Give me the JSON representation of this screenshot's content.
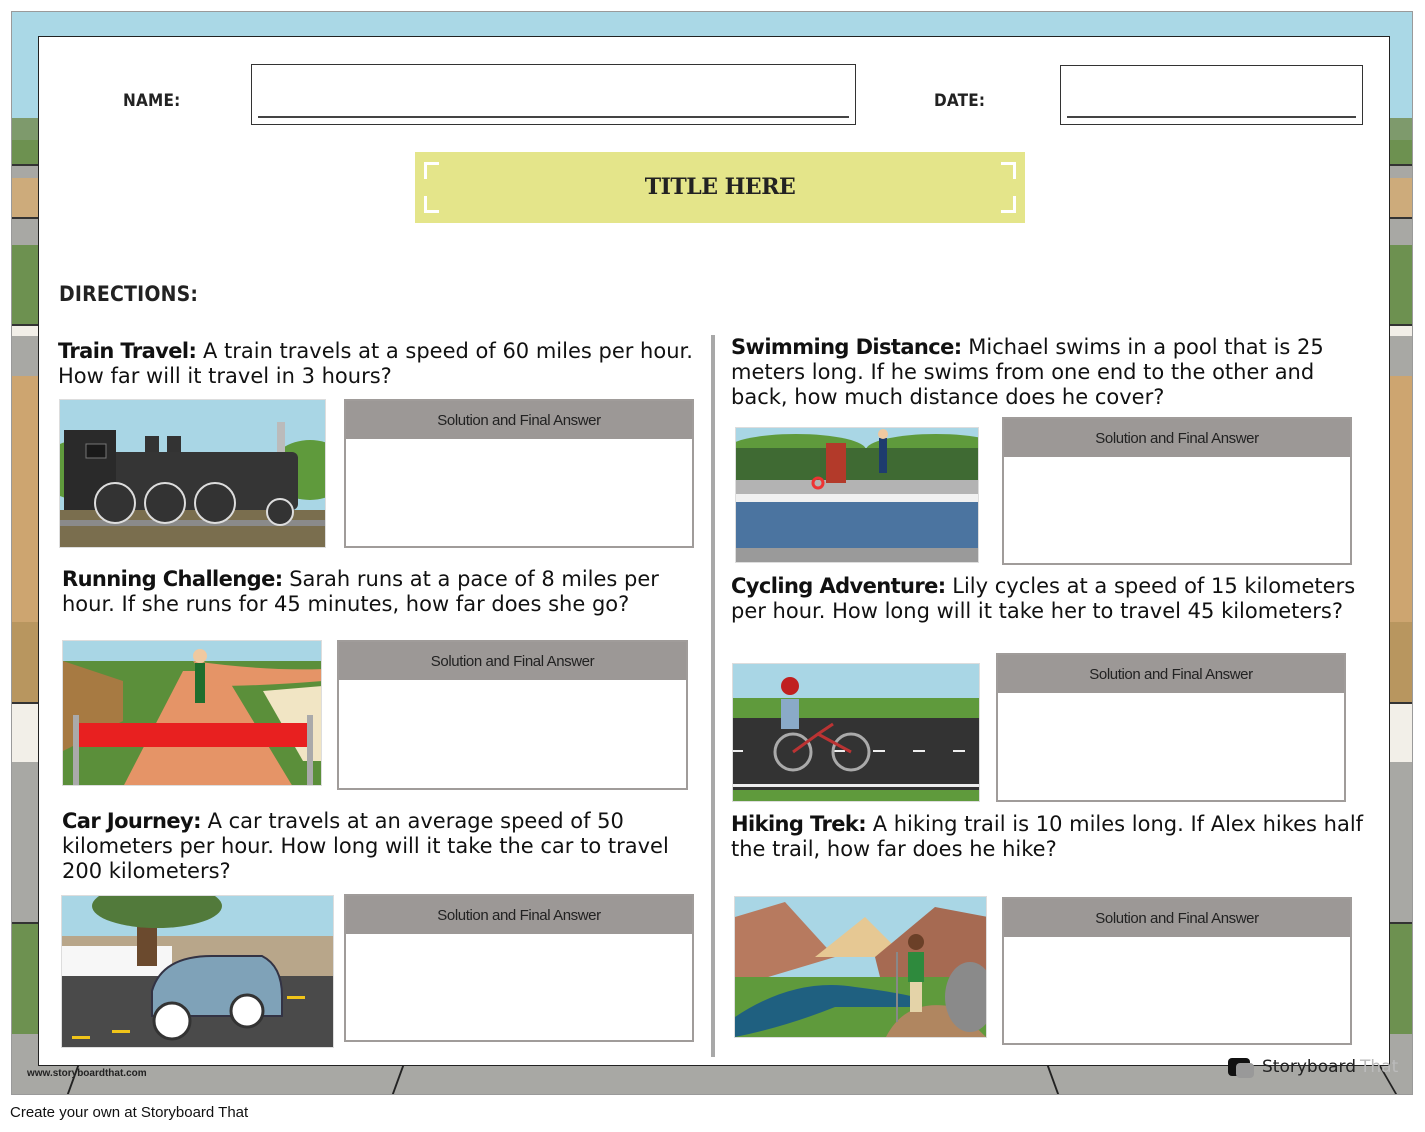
{
  "worksheet": {
    "name_label": "NAME:",
    "date_label": "DATE:",
    "name_value": "",
    "date_value": "",
    "title": "TITLE HERE",
    "directions_label": "DIRECTIONS:"
  },
  "problems": [
    {
      "heading": "Train Travel:",
      "body": " A train travels at a speed of 60 miles per hour. How far will it travel in 3 hours?",
      "image": "steam-locomotive-illustration",
      "answer_header": "Solution and Final Answer"
    },
    {
      "heading": "Running Challenge:",
      "body": " Sarah runs at a pace of 8 miles per hour. If she runs for 45 minutes, how far does she go?",
      "image": "running-track-finish-line-illustration",
      "answer_header": "Solution and Final Answer"
    },
    {
      "heading": "Car Journey:",
      "body": " A car travels at an average speed of 50 kilometers per hour. How long will it take the car to travel 200 kilometers?",
      "image": "vintage-car-road-illustration",
      "answer_header": "Solution and Final Answer"
    },
    {
      "heading": "Swimming Distance:",
      "body": " Michael swims in a pool that is 25 meters long. If he swims from one end to the other and back, how much distance does he cover?",
      "image": "swimming-pool-illustration",
      "answer_header": "Solution and Final Answer"
    },
    {
      "heading": "Cycling Adventure:",
      "body": " Lily cycles at a speed of 15 kilometers per hour. How long will it take her to travel 45 kilometers?",
      "image": "cyclist-road-illustration",
      "answer_header": "Solution and Final Answer"
    },
    {
      "heading": "Hiking Trek:",
      "body": " A hiking trail is 10 miles long. If Alex hikes half the trail, how far does he hike?",
      "image": "hiker-canyon-river-illustration",
      "answer_header": "Solution and Final Answer"
    }
  ],
  "branding": {
    "url": "www.storyboardthat.com",
    "logo_word1": "Storyboard",
    "logo_word2": "That",
    "footer": "Create your own at Storyboard That"
  },
  "colors": {
    "title_banner": "#e4e58a",
    "answer_header": "#9c9896",
    "frame_sky": "#aad8e6",
    "frame_grass": "#6d9150",
    "frame_sand": "#cda570"
  }
}
